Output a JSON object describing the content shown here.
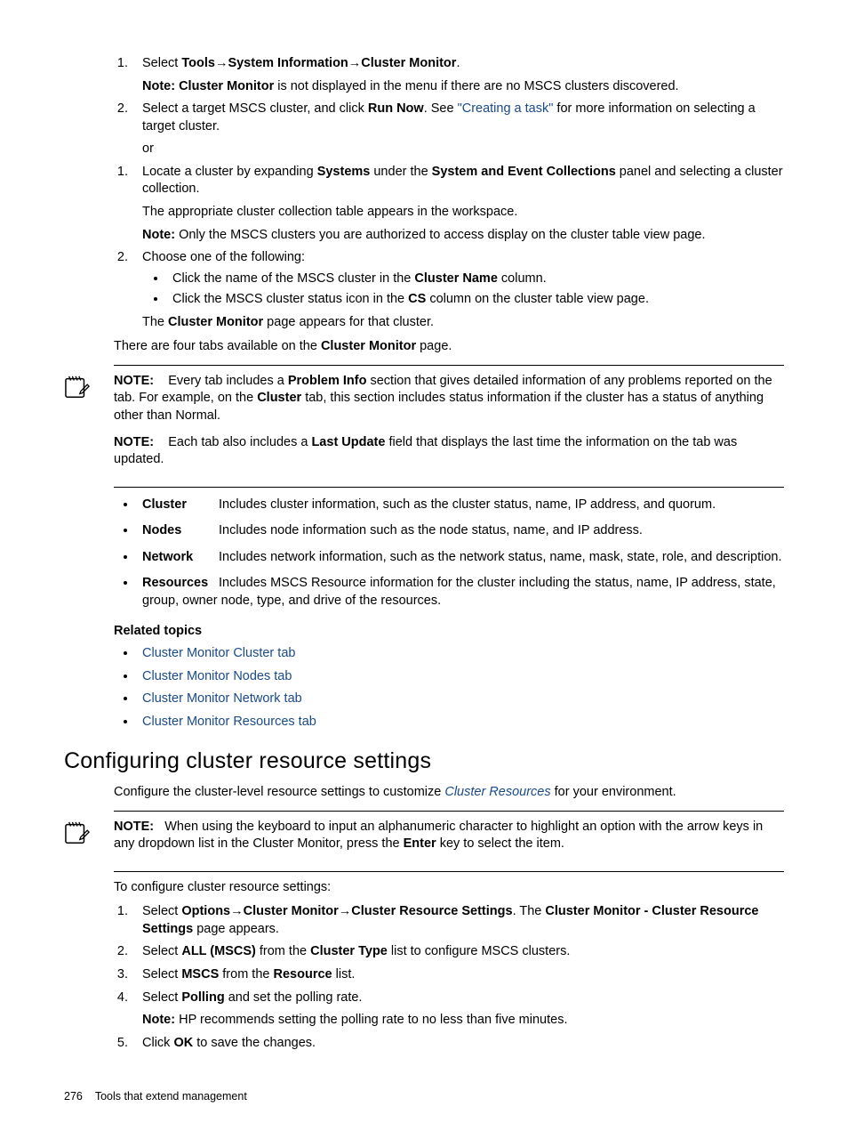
{
  "listA": {
    "step1": {
      "prefix": "Select ",
      "tools": "Tools",
      "sysinfo": "System Information",
      "clustermon": "Cluster Monitor",
      "dot": ".",
      "note_label": "Note: Cluster Monitor",
      "note_rest": " is not displayed in the menu if there are no MSCS clusters discovered."
    },
    "step2": {
      "a": "Select a target MSCS cluster, and click ",
      "b": "Run Now",
      "c": ". See ",
      "link": "\"Creating a task\"",
      "d": " for more information on selecting a target cluster."
    },
    "or": "or"
  },
  "listB": {
    "step1": {
      "a": "Locate a cluster by expanding ",
      "b": "Systems",
      "c": " under the ",
      "d": "System and Event Collections",
      "e": " panel and selecting a cluster collection.",
      "sub1": "The appropriate cluster collection table appears in the workspace.",
      "note_label": "Note:",
      "note_rest": " Only the MSCS clusters you are authorized to access display on the cluster table view page."
    },
    "step2": {
      "intro": "Choose one of the following:",
      "b1a": "Click the name of the MSCS cluster in the ",
      "b1b": "Cluster Name",
      "b1c": " column.",
      "b2a": "Click the MSCS cluster status icon in the ",
      "b2b": "CS",
      "b2c": " column on the cluster table view page.",
      "res_a": "The ",
      "res_b": "Cluster Monitor",
      "res_c": " page appears for that cluster."
    }
  },
  "tabs_intro_a": "There are four tabs available on the ",
  "tabs_intro_b": "Cluster Monitor",
  "tabs_intro_c": " page.",
  "note1": {
    "label": "NOTE:",
    "a": "Every tab includes a ",
    "b": "Problem Info",
    "c": " section that gives detailed information of any problems reported on the tab. For example, on the ",
    "d": "Cluster",
    "e": " tab, this section includes status information if the cluster has a status of anything other than Normal."
  },
  "note2": {
    "label": "NOTE:",
    "a": "Each tab also includes a ",
    "b": "Last Update",
    "c": " field that displays the last time the information on the tab was updated."
  },
  "tabs": {
    "cluster_l": "Cluster",
    "cluster_t": "Includes cluster information, such as the cluster status, name, IP address, and quorum.",
    "nodes_l": "Nodes",
    "nodes_t": "Includes node information such as the node status, name, and IP address.",
    "network_l": "Network",
    "network_t": "Includes network information, such as the network status, name, mask, state, role, and description.",
    "resources_l": "Resources",
    "resources_t": "Includes MSCS Resource information for the cluster including the status, name, IP address, state, group, owner node, type, and drive of the resources."
  },
  "related_heading": "Related topics",
  "related": {
    "l1": "Cluster Monitor Cluster tab",
    "l2": "Cluster Monitor Nodes tab",
    "l3": "Cluster Monitor Network tab",
    "l4": "Cluster Monitor Resources tab"
  },
  "section2": {
    "heading": "Configuring cluster resource settings",
    "intro_a": "Configure the cluster-level resource settings to customize ",
    "intro_link": "Cluster Resources",
    "intro_b": " for your environment.",
    "note_label": "NOTE:",
    "note_a": "When using the keyboard to input an alphanumeric character to highlight an option with the arrow keys in any dropdown list in the Cluster Monitor, press the ",
    "note_b": "Enter",
    "note_c": " key to select the item.",
    "lead": "To configure cluster resource settings:",
    "s1a": "Select ",
    "s1b": "Options",
    "s1c": "Cluster Monitor",
    "s1d": "Cluster Resource Settings",
    "s1e": ". The ",
    "s1f": "Cluster Monitor - Cluster Resource Settings",
    "s1g": " page appears.",
    "s2a": "Select ",
    "s2b": "ALL (MSCS)",
    "s2c": " from the ",
    "s2d": "Cluster Type",
    "s2e": " list to configure MSCS clusters.",
    "s3a": "Select ",
    "s3b": "MSCS",
    "s3c": " from the ",
    "s3d": "Resource",
    "s3e": " list.",
    "s4a": "Select ",
    "s4b": "Polling",
    "s4c": " and set the polling rate.",
    "s4note_l": "Note:",
    "s4note_t": " HP recommends setting the polling rate to no less than five minutes.",
    "s5a": "Click ",
    "s5b": "OK",
    "s5c": " to save the changes."
  },
  "footer": {
    "page": "276",
    "title": "Tools that extend management"
  }
}
